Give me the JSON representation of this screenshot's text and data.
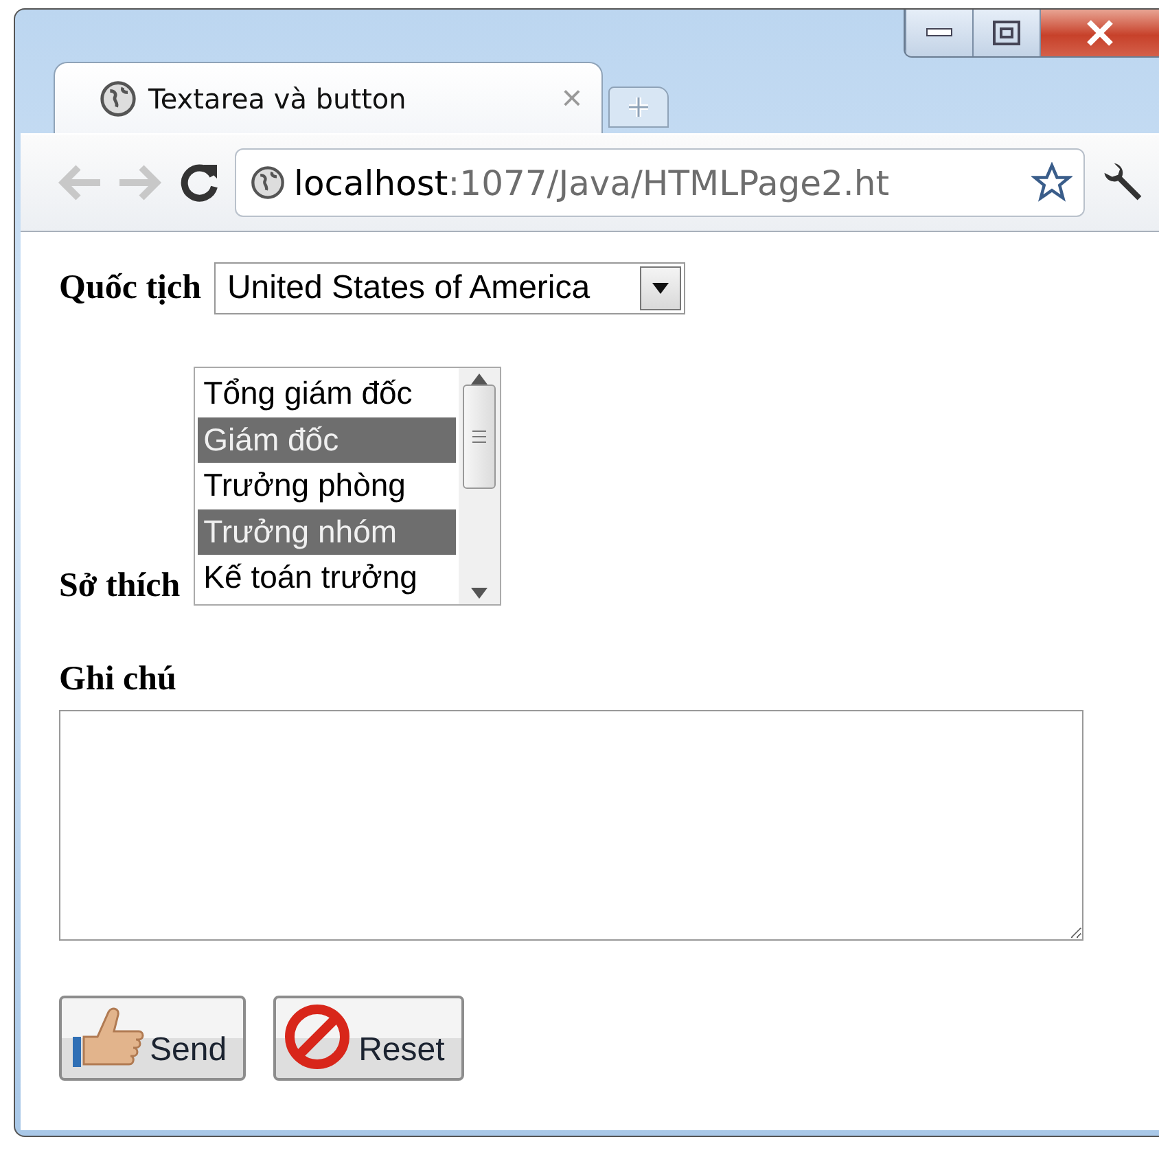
{
  "tab": {
    "title": "Textarea và button",
    "close": "×"
  },
  "address": {
    "host": "localhost",
    "path": ":1077/Java/HTMLPage2.ht"
  },
  "form": {
    "nationality": {
      "label": "Quốc tịch",
      "value": "United States of America"
    },
    "hobbies": {
      "label": "Sở thích",
      "options": [
        {
          "text": "Tổng giám đốc",
          "selected": false
        },
        {
          "text": "Giám đốc",
          "selected": true
        },
        {
          "text": "Trưởng phòng",
          "selected": false
        },
        {
          "text": "Trưởng nhóm",
          "selected": true
        },
        {
          "text": "Kế toán trưởng",
          "selected": false
        }
      ]
    },
    "note": {
      "label": "Ghi chú"
    },
    "buttons": [
      {
        "kind": "send",
        "label": "Send"
      },
      {
        "kind": "reset",
        "label": "Reset"
      }
    ]
  }
}
